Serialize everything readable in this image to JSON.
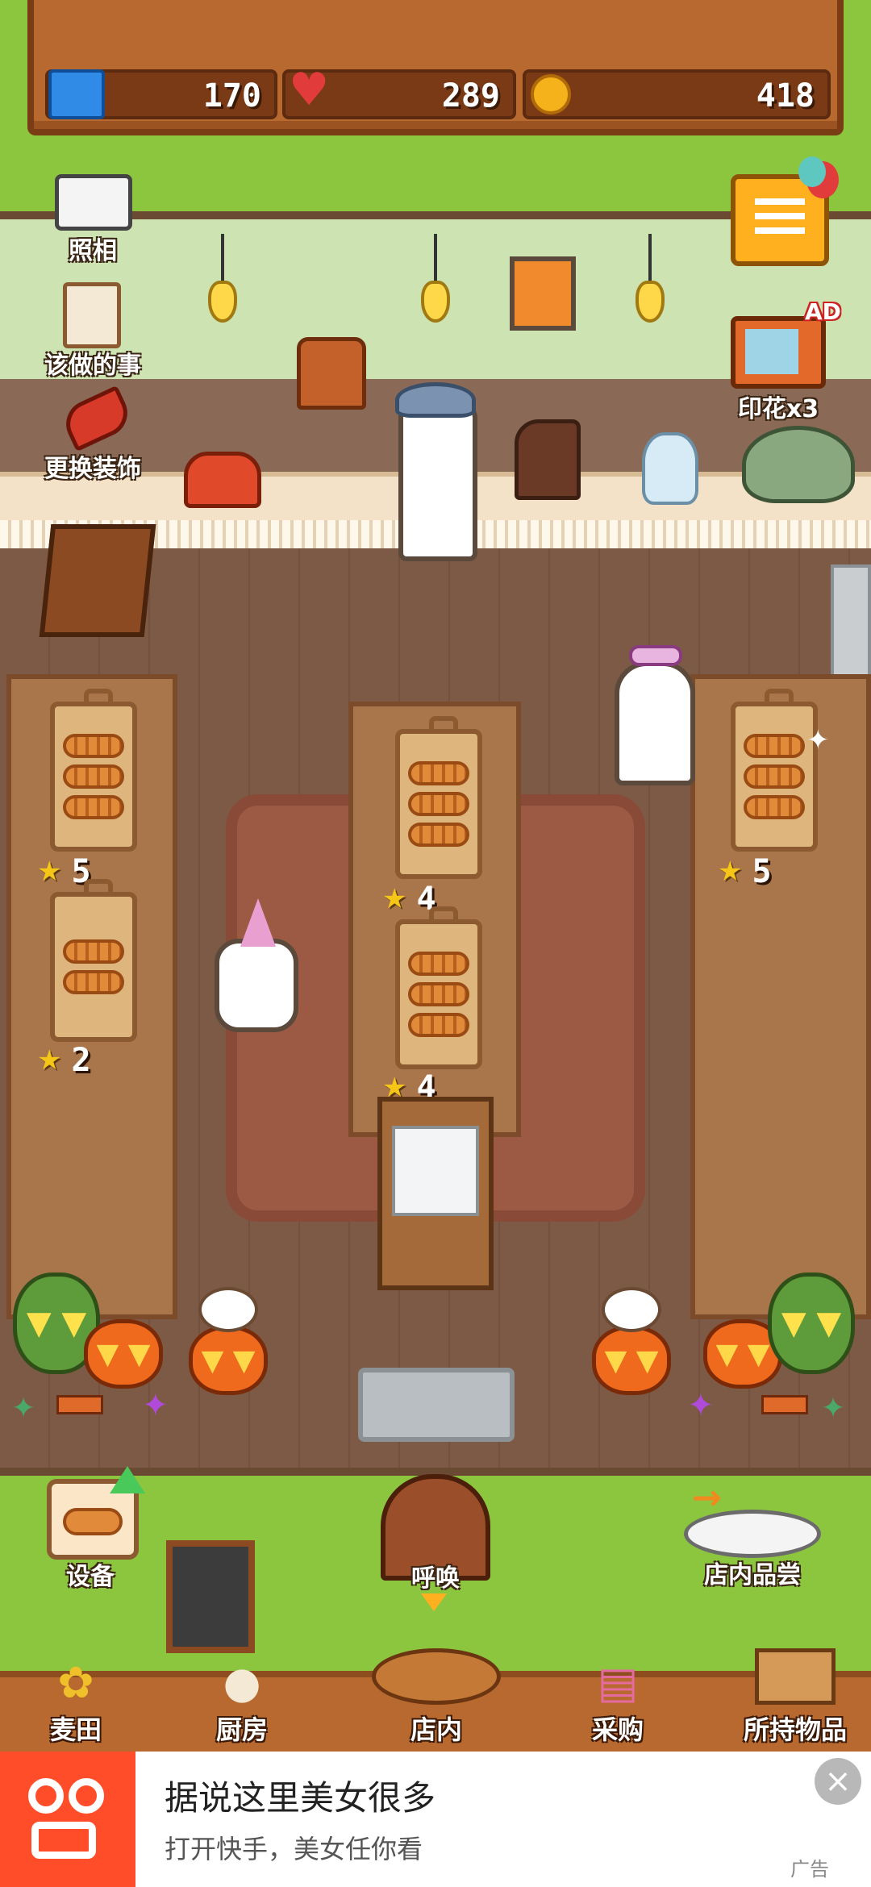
{
  "stats": {
    "tickets": "170",
    "hearts": "289",
    "coins": "418"
  },
  "side_menu": {
    "camera": "照相",
    "todo": "该做的事",
    "decorate": "更换装饰",
    "stamp_ad_badge": "AD",
    "stamp": "印花x3"
  },
  "tables": {
    "left_top_stars": "5",
    "left_bottom_stars": "2",
    "mid_top_stars": "4",
    "mid_bottom_stars": "4",
    "right_stars": "5"
  },
  "actions": {
    "equipment": "设备",
    "call": "呼唤",
    "tasting": "店内品尝"
  },
  "nav": {
    "items": [
      {
        "label": "麦田",
        "icon": "wheat-icon"
      },
      {
        "label": "厨房",
        "icon": "kitchen-icon"
      },
      {
        "label": "店内",
        "icon": "bread-basket-icon"
      },
      {
        "label": "采购",
        "icon": "shop-icon"
      },
      {
        "label": "所持物品",
        "icon": "box-icon"
      }
    ]
  },
  "ad": {
    "title": "据说这里美女很多",
    "subtitle": "打开快手，美女任你看",
    "tag": "广告"
  },
  "colors": {
    "grass": "#8cc63f",
    "wood": "#b8692f",
    "heart": "#e23b3b",
    "coin": "#f5b21b",
    "ticket": "#2f8be6"
  }
}
